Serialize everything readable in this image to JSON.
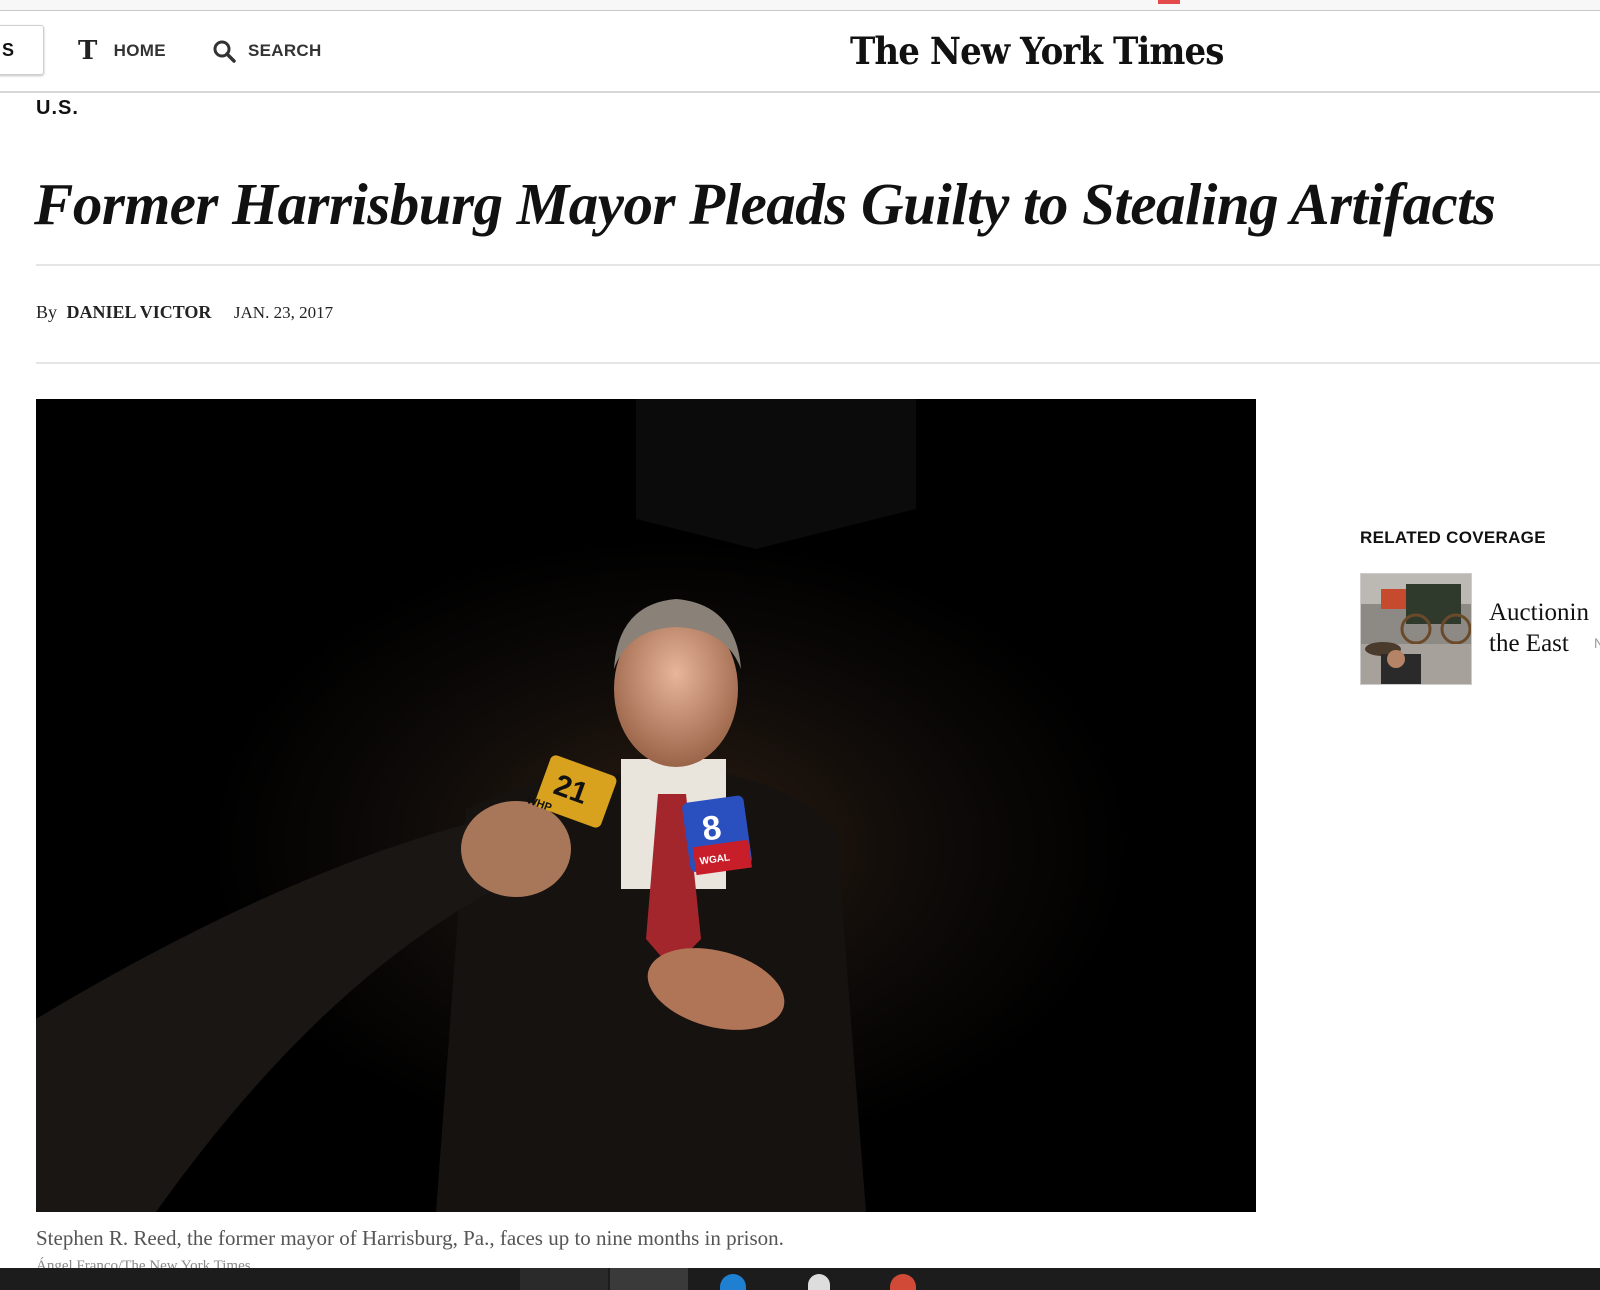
{
  "navbar": {
    "sections_label": "IS",
    "home_label": "HOME",
    "search_label": "SEARCH",
    "masthead": "The New York Times"
  },
  "article": {
    "section": "U.S.",
    "headline": "Former Harrisburg Mayor Pleads Guilty to Stealing Artifacts",
    "byline_prefix": "By",
    "author": "DANIEL VICTOR",
    "date": "JAN. 23, 2017",
    "photo_caption": "Stephen R. Reed, the former mayor of Harrisburg, Pa., faces up to nine months in prison.",
    "photo_credit": "Ángel Franco/The New York Times",
    "photo_mic_labels": [
      "21",
      "WHP",
      "8",
      "WGAL"
    ]
  },
  "related": {
    "title": "RELATED COVERAGE",
    "items": [
      {
        "headline_line1": "Auctionin",
        "headline_line2": "the East",
        "tag": "N"
      }
    ]
  },
  "colors": {
    "text": "#111111",
    "caption": "#555555",
    "rule": "#e5e5e5",
    "taskbar": "#1c1c1c"
  }
}
